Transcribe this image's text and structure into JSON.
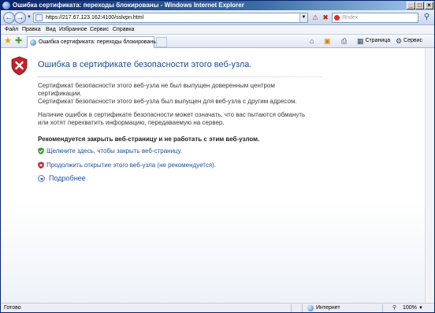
{
  "window": {
    "title": "Ошибка сертификата: переходы блокированы - Windows Internet Explorer",
    "min": "_",
    "max": "□",
    "close": "×"
  },
  "address": {
    "url": "https://217.67.123.162:4100/sslvpn.html",
    "search_placeholder": "Яndex"
  },
  "menu": [
    "Файл",
    "Правка",
    "Вид",
    "Избранное",
    "Сервис",
    "Справка"
  ],
  "tab": {
    "label": "Ошибка сертификата: переходы блокированы"
  },
  "commands": {
    "page": "Страница",
    "tools": "Сервис"
  },
  "page": {
    "title": "Ошибка в сертификате безопасности этого веб-узла.",
    "p1_line1": "Сертификат безопасности этого веб-узла не был выпущен доверенным центром",
    "p1_line2": "сертификации.",
    "p1_line3": "Сертификат безопасности этого веб-узла был выпущен для веб-узла с другим адресом.",
    "p2_line1": "Наличие ошибок в сертификате безопасности может означать, что вас пытаются обмануть",
    "p2_line2": "или хотят перехватить информацию, передаваемую на сервер.",
    "recommendation": "Рекомендуется закрыть веб-страницу и не работать с этим веб-узлом.",
    "close_link": "Щелкните здесь, чтобы закрыть веб-страницу.",
    "continue_link": "Продолжить открытие этого веб-узла (не рекомендуется).",
    "more_info": "Подробнее"
  },
  "status": {
    "left": "Готово",
    "zone": "Интернет",
    "zoom": "100%"
  },
  "colors": {
    "title_blue": "#1f4c92",
    "link_blue": "#1f4f9a",
    "shield_red": "#c0232a",
    "shield_green": "#3a9a2b"
  }
}
